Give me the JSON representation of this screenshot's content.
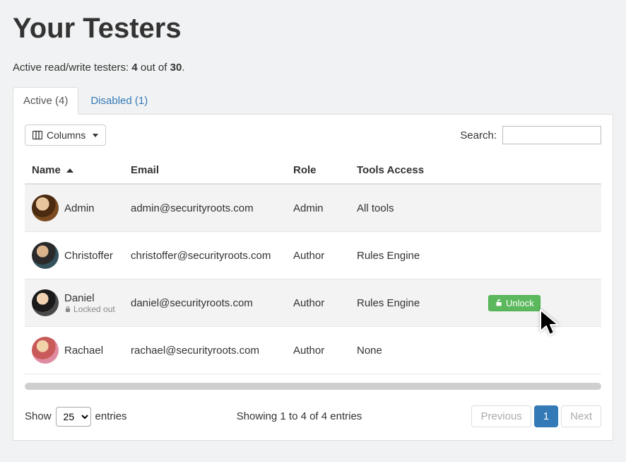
{
  "header": {
    "title": "Your Testers",
    "subtext_prefix": "Active read/write testers: ",
    "count_active": "4",
    "out_of_word": " out of ",
    "count_total": "30",
    "period": "."
  },
  "tabs": {
    "active_label": "Active (4)",
    "disabled_label": "Disabled (1)"
  },
  "toolbar": {
    "columns_label": "Columns",
    "search_label": "Search:"
  },
  "table": {
    "headers": {
      "name": "Name",
      "email": "Email",
      "role": "Role",
      "tools": "Tools Access"
    },
    "rows": [
      {
        "name": "Admin",
        "email": "admin@securityroots.com",
        "role": "Admin",
        "tools": "All tools",
        "locked": false
      },
      {
        "name": "Christoffer",
        "email": "christoffer@securityroots.com",
        "role": "Author",
        "tools": "Rules Engine",
        "locked": false
      },
      {
        "name": "Daniel",
        "email": "daniel@securityroots.com",
        "role": "Author",
        "tools": "Rules Engine",
        "locked": true,
        "locked_label": "Locked out",
        "unlock_label": "Unlock"
      },
      {
        "name": "Rachael",
        "email": "rachael@securityroots.com",
        "role": "Author",
        "tools": "None",
        "locked": false
      }
    ]
  },
  "footer": {
    "show_label": "Show",
    "entries_label": "entries",
    "page_size": "25",
    "info_text": "Showing 1 to 4 of 4 entries",
    "prev_label": "Previous",
    "page1_label": "1",
    "next_label": "Next"
  }
}
